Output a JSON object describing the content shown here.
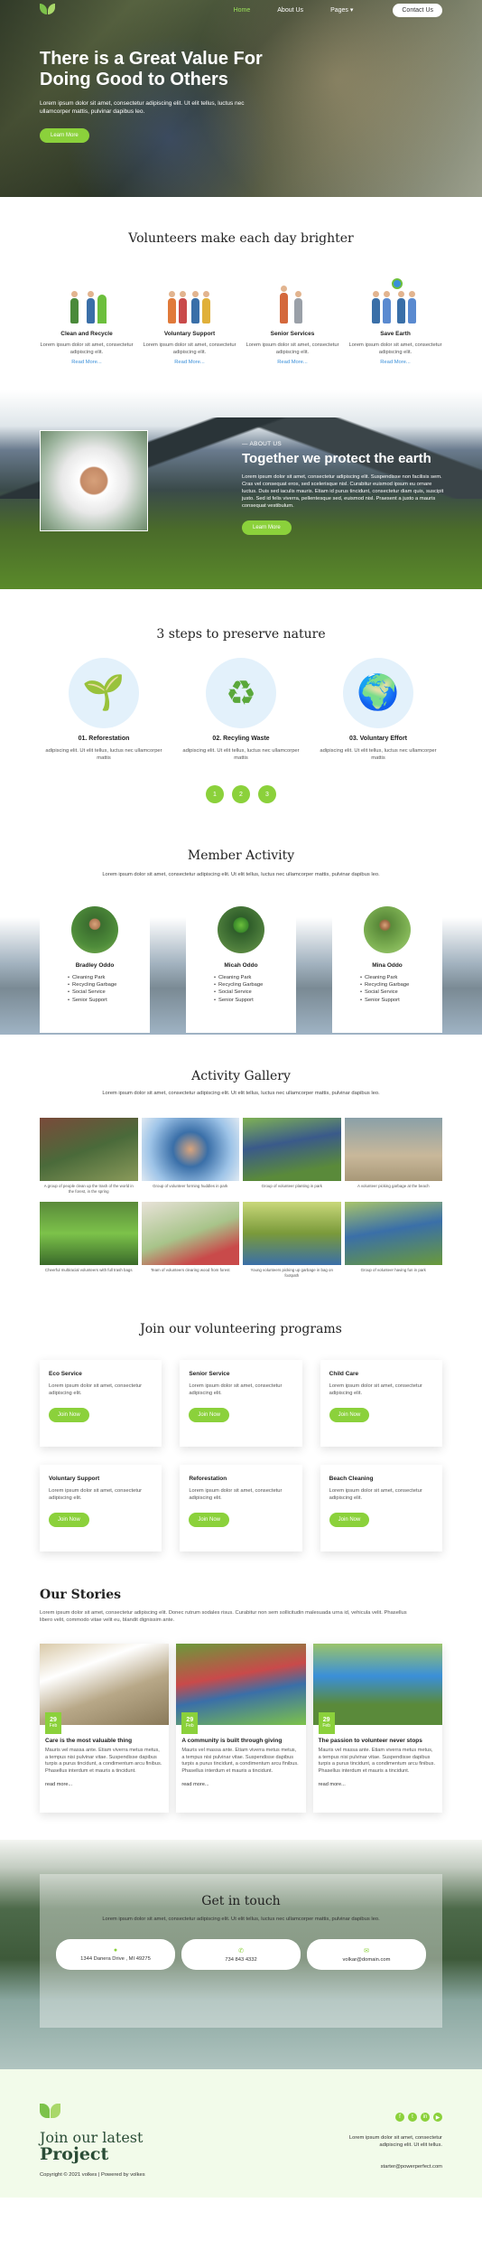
{
  "nav": {
    "links": [
      "Home",
      "About Us",
      "Pages ▾"
    ],
    "contact": "Contact Us"
  },
  "hero": {
    "title": "There is a Great Value For Doing Good to Others",
    "text": "Lorem ipsum dolor sit amet, consectetur adipiscing elit. Ut elit tellus, luctus nec ullamcorper mattis, pulvinar dapibus leo.",
    "button": "Learn More"
  },
  "volunteers": {
    "title": "Volunteers make each day brighter",
    "items": [
      {
        "title": "Clean and Recycle",
        "text": "Lorem ipsum dolor sit amet, consectetur adipiscing elit.",
        "link": "Read More..."
      },
      {
        "title": "Voluntary Support",
        "text": "Lorem ipsum dolor sit amet, consectetur adipiscing elit.",
        "link": "Read More..."
      },
      {
        "title": "Senior Services",
        "text": "Lorem ipsum dolor sit amet, consectetur adipiscing elit.",
        "link": "Read More..."
      },
      {
        "title": "Save Earth",
        "text": "Lorem ipsum dolor sit amet, consectetur adipiscing elit.",
        "link": "Read More..."
      }
    ]
  },
  "about": {
    "kicker": "— ABOUT US",
    "title": "Together we protect the earth",
    "text": "Lorem ipsum dolor sit amet, consectetur adipiscing elit. Suspendisse non facilisis sem. Cras vel consequat eros, sed scelerisque nisl. Curabitur euismod ipsum eu ornare luctus. Duis sed iaculis mauris. Etiam id purus tincidunt, consectetur diam quis, suscipit justo. Sed id felis viverra, pellentesque sed, euismod nisl. Praesent a justo a mauris consequat vestibulum.",
    "button": "Learn More"
  },
  "steps": {
    "title": "3 steps to preserve nature",
    "items": [
      {
        "icon": "🌱",
        "title": "01. Reforestation",
        "text": "adipiscing elit. Ut elit tellus, luctus nec ullamcorper mattis"
      },
      {
        "icon": "♻",
        "title": "02. Recyling Waste",
        "text": "adipiscing elit. Ut elit tellus, luctus nec ullamcorper mattis"
      },
      {
        "icon": "🌍",
        "title": "03. Voluntary Effort",
        "text": "adipiscing elit. Ut elit tellus, luctus nec ullamcorper mattis"
      }
    ],
    "pager": [
      "1",
      "2",
      "3"
    ]
  },
  "members": {
    "title": "Member Activity",
    "sub": "Lorem ipsum dolor sit amet, consectetur adipiscing elit. Ut elit tellus, luctus nec ullamcorper mattis, pulvinar dapibus leo.",
    "cards": [
      {
        "name": "Bradley Oddo",
        "list": [
          "Cleaning Park",
          "Recycling Garbage",
          "Social Service",
          "Senior Support"
        ]
      },
      {
        "name": "Micah Oddo",
        "list": [
          "Cleaning Park",
          "Recycling Garbage",
          "Social Service",
          "Senior Support"
        ]
      },
      {
        "name": "Mina Oddo",
        "list": [
          "Cleaning Park",
          "Recycling Garbage",
          "Social Service",
          "Senior Support"
        ]
      }
    ]
  },
  "gallery": {
    "title": "Activity Gallery",
    "sub": "Lorem ipsum dolor sit amet, consectetur adipiscing elit. Ut elit tellus, luctus nec ullamcorper mattis, pulvinar dapibus leo.",
    "items": [
      "A group of people clean up the trash of the world in the forest, in the spring",
      "Group of volunteer forming huddles in park",
      "Group of volunteer planting in park",
      "A volunteer picking garbage at the beach",
      "Cheerful multiracial volunteers with full trash bags",
      "Team of volunteers clearing wood from forest",
      "Young volunteers picking up garbage in bag on footpath",
      "Group of volunteer having fun in park"
    ]
  },
  "programs": {
    "title": "Join our volunteering programs",
    "items": [
      {
        "title": "Eco Service",
        "text": "Lorem ipsum dolor sit amet, consectetur adipiscing elit.",
        "button": "Join Now"
      },
      {
        "title": "Senior Service",
        "text": "Lorem ipsum dolor sit amet, consectetur adipiscing elit.",
        "button": "Join Now"
      },
      {
        "title": "Child Care",
        "text": "Lorem ipsum dolor sit amet, consectetur adipiscing elit.",
        "button": "Join Now"
      },
      {
        "title": "Voluntary Support",
        "text": "Lorem ipsum dolor sit amet, consectetur adipiscing elit.",
        "button": "Join Now"
      },
      {
        "title": "Reforestation",
        "text": "Lorem ipsum dolor sit amet, consectetur adipiscing elit.",
        "button": "Join Now"
      },
      {
        "title": "Beach Cleaning",
        "text": "Lorem ipsum dolor sit amet, consectetur adipiscing elit.",
        "button": "Join Now"
      }
    ]
  },
  "stories": {
    "title": "Our Stories",
    "intro": "Lorem ipsum dolor sit amet, consectetur adipiscing elit. Donec rutrum sodales risus. Curabitur non sem sollicitudin malesuada urna id, vehicula velit. Phasellus libero velit, commodo vitae velit eu, blandit dignissim ante.",
    "items": [
      {
        "day": "29",
        "month": "Feb",
        "title": "Care is the most valuable thing",
        "text": "Mauris vel massa ante. Etiam viverra metus metus, a tempus nisi pulvinar vitae. Suspendisse dapibus turpis a purus tincidunt, a condimentum arcu finibus. Phasellus interdum et mauris a tincidunt.",
        "link": "read more..."
      },
      {
        "day": "29",
        "month": "Feb",
        "title": "A community is built through giving",
        "text": "Mauris vel massa ante. Etiam viverra metus metus, a tempus nisi pulvinar vitae. Suspendisse dapibus turpis a purus tincidunt, a condimentum arcu finibus. Phasellus interdum et mauris a tincidunt.",
        "link": "read more..."
      },
      {
        "day": "29",
        "month": "Feb",
        "title": "The passion to volunteer never stops",
        "text": "Mauris vel massa ante. Etiam viverra metus metus, a tempus nisi pulvinar vitae. Suspendisse dapibus turpis a purus tincidunt, a condimentum arcu finibus. Phasellus interdum et mauris a tincidunt.",
        "link": "read more..."
      }
    ]
  },
  "contact": {
    "title": "Get in touch",
    "sub": "Lorem ipsum dolor sit amet, consectetur adipiscing elit. Ut elit tellus, luctus nec ullamcorper mattis, pulvinar dapibus leo.",
    "address": "1344 Danera Drive , MI 49275",
    "phone": "734 843 4332",
    "email": "volkar@domain.com"
  },
  "footer": {
    "heading_line1": "Join our latest",
    "heading_line2": "Project",
    "copyright": "Copyright © 2021 volkes | Powered by volkes",
    "text": "Lorem ipsum dolor sit amet, consectetur adipiscing elit. Ut elit tellus.",
    "email": "starter@powerperfect.com",
    "socials": [
      "f",
      "t",
      "in",
      "▶"
    ]
  },
  "colors": {
    "accent": "#8bd13b",
    "link": "#3a8fd9",
    "dark_green": "#2a4c36"
  }
}
